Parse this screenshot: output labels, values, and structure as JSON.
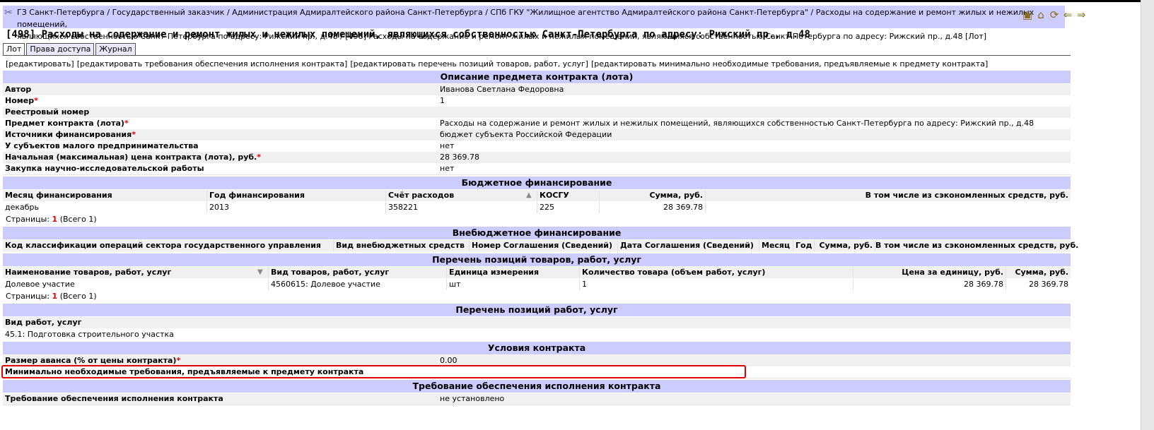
{
  "breadcrumb": {
    "line1": "ГЗ Санкт-Петербурга / Государственный заказчик / Администрация Адмиралтейского района Санкт-Петербурга / СПб ГКУ \"Жилищное агентство Адмиралтейского района Санкт-Петербурга\" / Расходы на содержание и ремонт жилых и нежилых помещений,",
    "line2": "являющихся собственностью Санкт-Петербурга по адресу: Рижский пр., д.48 / [498] Расходы на содержание и ремонт жилых и нежилых помещений, являющихся собственностью Санкт-Петербурга по адресу: Рижский пр., д.48 [Лот]"
  },
  "toolbar": {
    "icons": [
      "folder-icon",
      "home-icon",
      "refresh-icon",
      "back-icon",
      "forward-icon"
    ]
  },
  "page_title": "[498] Расходы на содержание и ремонт жилых и нежилых помещений, являющихся собственностью Санкт-Петербурга по адресу: Рижский пр., д.48",
  "tabs": [
    "Лот",
    "Права доступа",
    "Журнал"
  ],
  "actions": [
    "[редактировать]",
    "[редактировать требования обеспечения исполнения контракта]",
    "[редактировать перечень позиций товаров, работ, услуг]",
    "[редактировать минимально необходимые требования, предъявляемые к предмету контракта]"
  ],
  "sections": {
    "subject": "Описание предмета контракта (лота)",
    "budget": "Бюджетное финансирование",
    "extrabudget": "Внебюджетное финансирование",
    "goods": "Перечень позиций товаров, работ, услуг",
    "works": "Перечень позиций работ, услуг",
    "conditions": "Условия контракта",
    "guarantee": "Требование обеспечения исполнения контракта"
  },
  "subject_rows": [
    {
      "label": "Автор",
      "star": "",
      "value": "Иванова Светлана Федоровна"
    },
    {
      "label": "Номер",
      "star": "*",
      "value": "1"
    },
    {
      "label": "Реестровый номер",
      "star": "",
      "value": ""
    },
    {
      "label": "Предмет контракта (лота)",
      "star": "*",
      "value": "Расходы на содержание и ремонт жилых и нежилых помещений, являющихся собственностью Санкт-Петербурга по адресу: Рижский пр., д.48"
    },
    {
      "label": "Источники финансирования",
      "star": "*",
      "value": "бюджет субъекта Российской Федерации"
    },
    {
      "label": "У субъектов малого предпринимательства",
      "star": "",
      "value": "нет"
    },
    {
      "label": "Начальная (максимальная) цена контракта (лота), руб.",
      "star": "*",
      "value": "28 369.78"
    },
    {
      "label": "Закупка научно-исследовательской работы",
      "star": "",
      "value": "нет"
    }
  ],
  "budget_table": {
    "headers": [
      "Месяц финансирования",
      "Год финансирования",
      "Счёт расходов",
      "КОСГУ",
      "Сумма, руб.",
      "В том числе из сэкономленных средств, руб."
    ],
    "rows": [
      [
        "декабрь",
        "2013",
        "358221",
        "225",
        "28 369.78",
        ""
      ]
    ]
  },
  "pages_label": "Страницы:",
  "pages_num": "1",
  "pages_total": "(Всего 1)",
  "extrabudget_headers": [
    "Код классификации операций сектора государственного управления",
    "Вид внебюджетных средств",
    "Номер Соглашения (Сведений)",
    "Дата Соглашения (Сведений)",
    "Месяц",
    "Год",
    "Сумма, руб.",
    "В том числе из сэкономленных средств, руб."
  ],
  "goods_table": {
    "headers": [
      "Наименование товаров, работ, услуг",
      "Вид товаров, работ, услуг",
      "Единица измерения",
      "Количество товара (объем работ, услуг)",
      "Цена за единицу, руб.",
      "Сумма, руб."
    ],
    "rows": [
      [
        "Долевое участие",
        "4560615: Долевое участие",
        "шт",
        "1",
        "28 369.78",
        "28 369.78"
      ]
    ]
  },
  "works": {
    "label": "Вид работ, услуг",
    "value": "45.1: Подготовка строительного участка"
  },
  "conditions_rows": [
    {
      "label": "Размер аванса (% от цены контракта)",
      "star": "*",
      "value": "0.00"
    },
    {
      "label": "Минимально необходимые требования, предъявляемые к предмету контракта",
      "star": "",
      "value": ""
    }
  ],
  "guarantee_row": {
    "label": "Требование обеспечения исполнения контракта",
    "value": "не установлено"
  }
}
